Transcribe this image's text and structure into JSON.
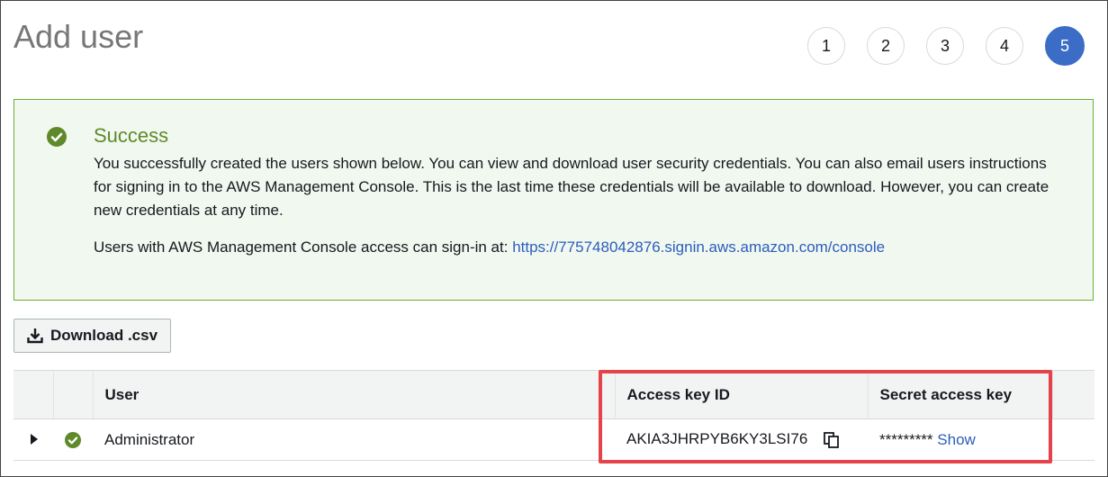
{
  "page": {
    "title": "Add user"
  },
  "steps": [
    "1",
    "2",
    "3",
    "4",
    "5"
  ],
  "active_step": "5",
  "alert": {
    "heading": "Success",
    "body": "You successfully created the users shown below. You can view and download user security credentials. You can also email users instructions for signing in to the AWS Management Console. This is the last time these credentials will be available to download. However, you can create new credentials at any time.",
    "signin_prefix": "Users with AWS Management Console access can sign-in at: ",
    "signin_url": "https://775748042876.signin.aws.amazon.com/console"
  },
  "download_button": {
    "label": "Download .csv"
  },
  "table": {
    "headers": {
      "user": "User",
      "access_key_id": "Access key ID",
      "secret_access_key": "Secret access key"
    },
    "rows": [
      {
        "user": "Administrator",
        "access_key_id": "AKIA3JHRPYB6KY3LSI76",
        "secret_masked": "*********",
        "show_label": "Show"
      }
    ]
  },
  "colors": {
    "accent": "#3b6dc6",
    "success": "#5f8a2a",
    "link": "#2c5dbd",
    "highlight": "#e5434a"
  }
}
